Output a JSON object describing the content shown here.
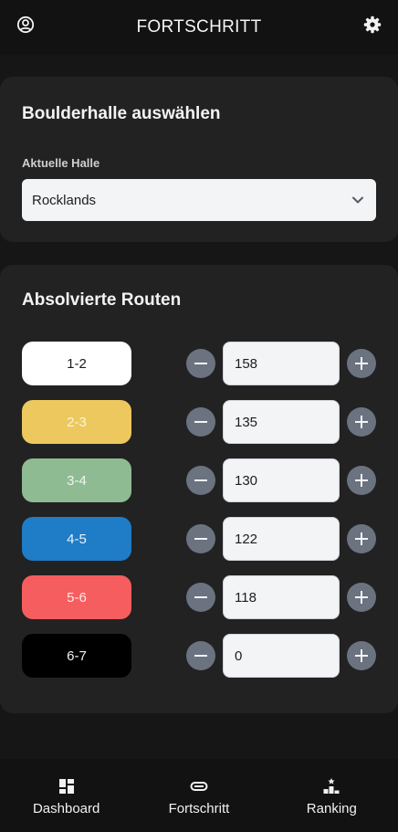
{
  "header": {
    "title": "FORTSCHRITT",
    "profile_icon": "user-circle-icon",
    "settings_icon": "gear-icon"
  },
  "hall": {
    "heading": "Boulderhalle auswählen",
    "label": "Aktuelle Halle",
    "selected": "Rocklands"
  },
  "routes": {
    "heading": "Absolvierte Routen",
    "items": [
      {
        "grade": "1-2",
        "count": "158",
        "color": "#ffffff",
        "text_color": "#1b1b1b"
      },
      {
        "grade": "2-3",
        "count": "135",
        "color": "#ecc85e",
        "text_color": "#fbf4dc"
      },
      {
        "grade": "3-4",
        "count": "130",
        "color": "#8fbb92",
        "text_color": "#eef6ee"
      },
      {
        "grade": "4-5",
        "count": "122",
        "color": "#1f7cc6",
        "text_color": "#eaf3fb"
      },
      {
        "grade": "5-6",
        "count": "118",
        "color": "#f65d5e",
        "text_color": "#fde9e9"
      },
      {
        "grade": "6-7",
        "count": "0",
        "color": "#000000",
        "text_color": "#f3f3f3"
      }
    ]
  },
  "nav": {
    "items": [
      {
        "label": "Dashboard",
        "icon": "dashboard-icon"
      },
      {
        "label": "Fortschritt",
        "icon": "progress-icon"
      },
      {
        "label": "Ranking",
        "icon": "ranking-podium-icon"
      }
    ]
  }
}
